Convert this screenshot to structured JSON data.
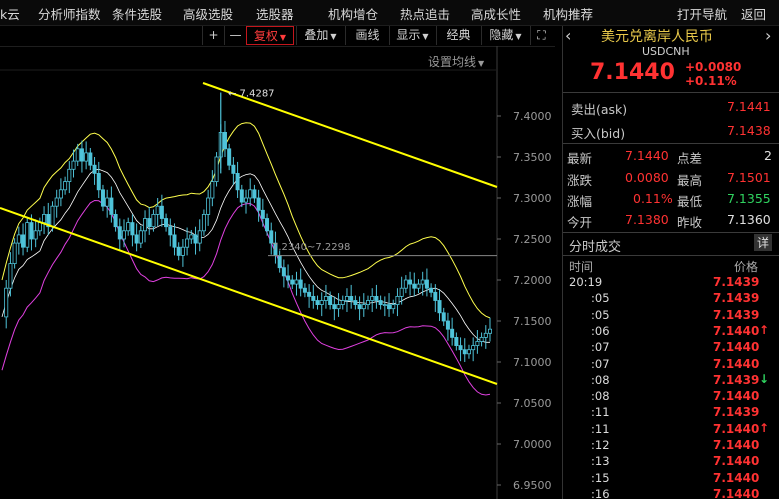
{
  "menu": [
    "k云",
    "分析师指数",
    "条件选股",
    "高级选股",
    "选股器",
    "机构增仓",
    "热点追击",
    "高成长性",
    "机构推荐",
    "打开导航",
    "返回"
  ],
  "toolbar": {
    "plus": "+",
    "minus": "—",
    "restore": "复权",
    "overlay": "叠加",
    "draw": "画线",
    "display": "显示",
    "classic": "经典",
    "hide": "隐藏",
    "expand_icon": "⛶",
    "indicator_setting": "设置均线"
  },
  "chart_data": {
    "type": "candlestick",
    "y_axis_ticks": [
      "7.4000",
      "7.3500",
      "7.3000",
      "7.2500",
      "7.2000",
      "7.1500",
      "7.1000",
      "7.0500",
      "7.0000",
      "6.9500"
    ],
    "ylim": [
      6.95,
      7.42
    ],
    "annotations": [
      {
        "text": "7.4287",
        "value": 7.4287
      },
      {
        "text": "7.2340~7.2298",
        "value": 7.234
      }
    ],
    "price_path": [
      7.155,
      7.19,
      7.22,
      7.245,
      7.255,
      7.24,
      7.27,
      7.25,
      7.26,
      7.27,
      7.28,
      7.265,
      7.29,
      7.3,
      7.31,
      7.32,
      7.335,
      7.345,
      7.36,
      7.345,
      7.355,
      7.34,
      7.33,
      7.31,
      7.29,
      7.3,
      7.28,
      7.265,
      7.25,
      7.26,
      7.27,
      7.255,
      7.245,
      7.26,
      7.275,
      7.265,
      7.28,
      7.29,
      7.275,
      7.265,
      7.255,
      7.24,
      7.23,
      7.24,
      7.25,
      7.255,
      7.245,
      7.26,
      7.28,
      7.3,
      7.32,
      7.35,
      7.38,
      7.36,
      7.34,
      7.33,
      7.31,
      7.295,
      7.3,
      7.31,
      7.3,
      7.285,
      7.275,
      7.26,
      7.245,
      7.23,
      7.215,
      7.205,
      7.2,
      7.195,
      7.2,
      7.19,
      7.185,
      7.18,
      7.175,
      7.17,
      7.175,
      7.18,
      7.17,
      7.165,
      7.17,
      7.175,
      7.18,
      7.175,
      7.17,
      7.165,
      7.17,
      7.175,
      7.18,
      7.175,
      7.17,
      7.17,
      7.165,
      7.17,
      7.18,
      7.19,
      7.2,
      7.195,
      7.19,
      7.195,
      7.2,
      7.19,
      7.185,
      7.175,
      7.16,
      7.15,
      7.14,
      7.13,
      7.12,
      7.115,
      7.11,
      7.115,
      7.12,
      7.125,
      7.13,
      7.135,
      7.14
    ]
  },
  "quote": {
    "title": "美元兑离岸人民币",
    "code": "USDCNH",
    "price": "7.1440",
    "change": "+0.0080",
    "change_pct": "+0.11%",
    "ask_label": "卖出(ask)",
    "ask_value": "7.1441",
    "bid_label": "买入(bid)",
    "bid_value": "7.1438",
    "stats": {
      "latest_label": "最新",
      "latest_value": "7.1440",
      "spread_label": "点差",
      "spread_value": "2",
      "change_label": "涨跌",
      "change_value": "0.0080",
      "high_label": "最高",
      "high_value": "7.1501",
      "pct_label": "涨幅",
      "pct_value": "0.11%",
      "low_label": "最低",
      "low_value": "7.1355",
      "open_label": "今开",
      "open_value": "7.1380",
      "prev_label": "昨收",
      "prev_value": "7.1360"
    },
    "ticks_title": "分时成交",
    "ticks_detail": "详",
    "time_header": "时间",
    "price_header": "价格",
    "ticks": [
      {
        "time": "20:19",
        "price": "7.1439",
        "arrow": ""
      },
      {
        "time": ":05",
        "price": "7.1439",
        "arrow": ""
      },
      {
        "time": ":05",
        "price": "7.1439",
        "arrow": ""
      },
      {
        "time": ":06",
        "price": "7.1440",
        "arrow": "up"
      },
      {
        "time": ":07",
        "price": "7.1440",
        "arrow": ""
      },
      {
        "time": ":07",
        "price": "7.1440",
        "arrow": ""
      },
      {
        "time": ":08",
        "price": "7.1439",
        "arrow": "down"
      },
      {
        "time": ":08",
        "price": "7.1440",
        "arrow": ""
      },
      {
        "time": ":11",
        "price": "7.1439",
        "arrow": ""
      },
      {
        "time": ":11",
        "price": "7.1440",
        "arrow": "up"
      },
      {
        "time": ":12",
        "price": "7.1440",
        "arrow": ""
      },
      {
        "time": ":13",
        "price": "7.1440",
        "arrow": ""
      },
      {
        "time": ":15",
        "price": "7.1440",
        "arrow": ""
      },
      {
        "time": ":16",
        "price": "7.1440",
        "arrow": ""
      }
    ]
  },
  "colors": {
    "up": "#ff3232",
    "down": "#2fd25f",
    "candle": "#4fc3d9",
    "channel": "#ffff00",
    "upper_band": "#ffff4d",
    "mid_band": "#ffffff",
    "lower_band": "#e040e0"
  }
}
